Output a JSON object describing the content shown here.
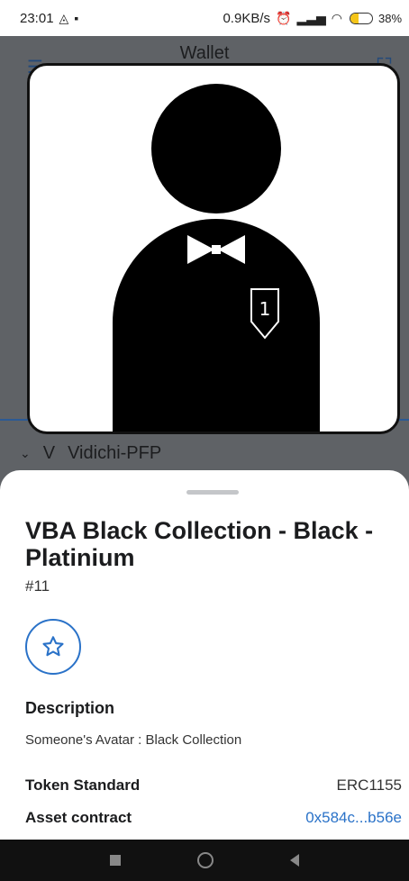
{
  "status_bar": {
    "time": "23:01",
    "network_speed": "0.9KB/s",
    "battery_percent": "38",
    "battery_suffix": "%",
    "battery_level": 0.38
  },
  "background": {
    "title": "Wallet",
    "collection_initial": "V",
    "collection_name": "Vidichi-PFP"
  },
  "nft": {
    "badge_number": "1",
    "title": "VBA Black Collection - Black - Platinium",
    "token_id": "#11"
  },
  "details": {
    "description_heading": "Description",
    "description": "Someone's Avatar : Black Collection",
    "token_standard_label": "Token Standard",
    "token_standard_value": "ERC1155",
    "asset_contract_label": "Asset contract",
    "asset_contract_value": "0x584c...b56e"
  },
  "colors": {
    "accent": "#2a72c8",
    "battery": "#f5c518"
  }
}
